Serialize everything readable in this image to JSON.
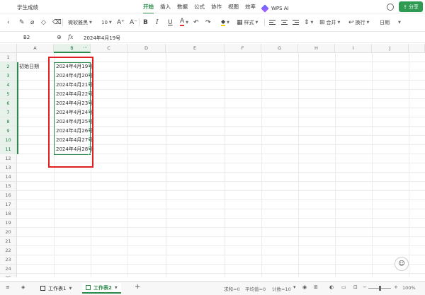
{
  "app": {
    "doc_title": "学生成绩",
    "menu_tabs": [
      "开始",
      "插入",
      "数据",
      "公式",
      "协作",
      "视图",
      "效率"
    ],
    "active_tab": "开始",
    "ai_label": "WPS AI",
    "share_label": "分享",
    "accent_color": "#2b8a4b"
  },
  "toolbar": {
    "font_name": "微软雅黑",
    "font_size": "10",
    "style_label": "样式",
    "merge_label": "合并",
    "wrap_label": "换行",
    "number_format": "日期"
  },
  "formula_bar": {
    "cell_ref": "B2",
    "value": "2024年4月19号"
  },
  "grid": {
    "columns": [
      "A",
      "B",
      "C",
      "D",
      "E",
      "F",
      "G",
      "H",
      "I",
      "J"
    ],
    "selected_column": "B",
    "rows": [
      "1",
      "2",
      "3",
      "4",
      "5",
      "6",
      "7",
      "8",
      "9",
      "10",
      "11",
      "12",
      "13",
      "14",
      "15",
      "16",
      "17",
      "18",
      "19",
      "20",
      "21",
      "22",
      "23",
      "24",
      "25"
    ],
    "cells": {
      "A2": "初始日期",
      "B": [
        "2024年4月19号",
        "2024年4月20号",
        "2024年4月21号",
        "2024年4月22号",
        "2024年4月23号",
        "2024年4月24号",
        "2024年4月25号",
        "2024年4月26号",
        "2024年4月27号",
        "2024年4月28号"
      ]
    }
  },
  "sheets": {
    "tabs": [
      "工作表1",
      "工作表2"
    ],
    "active": "工作表2"
  },
  "status": {
    "sum": "求和=0",
    "average": "平均值=0",
    "count": "计数=10",
    "zoom": "100%"
  }
}
